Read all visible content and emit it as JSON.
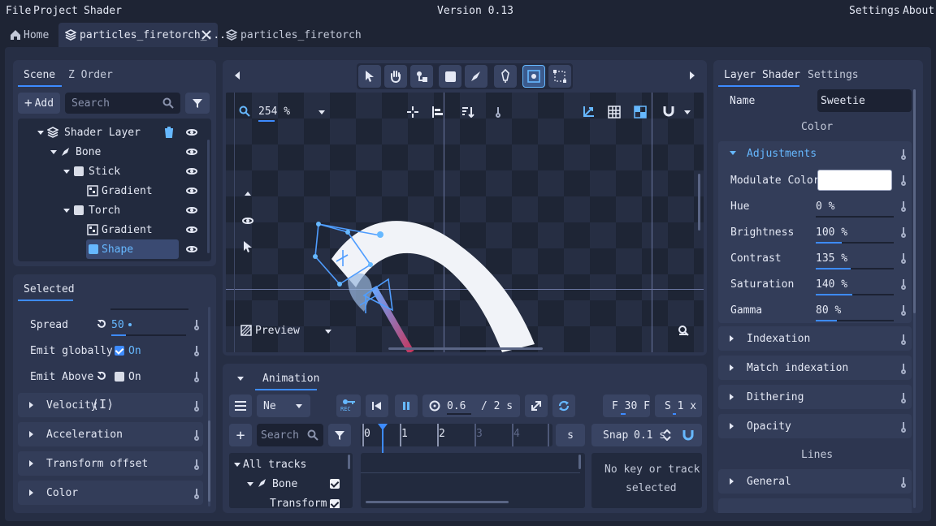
{
  "menu": {
    "file": "File",
    "project": "Project",
    "shader": "Shader",
    "version": "Version 0.13",
    "settings": "Settings",
    "about": "About"
  },
  "tabs": [
    {
      "label": "Home"
    },
    {
      "label": "particles_firetorch_..."
    },
    {
      "label": "particles_firetorch"
    }
  ],
  "scene": {
    "tab_scene": "Scene",
    "tab_zorder": "Z Order",
    "add": "Add",
    "search_placeholder": "Search",
    "tree": [
      {
        "label": "Shader Layer"
      },
      {
        "label": "Bone"
      },
      {
        "label": "Stick"
      },
      {
        "label": "Gradient"
      },
      {
        "label": "Torch"
      },
      {
        "label": "Gradient"
      },
      {
        "label": "Shape"
      }
    ]
  },
  "selected": {
    "title": "Selected",
    "spread_label": "Spread",
    "spread_value": "50",
    "emit_globally_label": "Emit globally",
    "emit_globally_value": "On",
    "emit_above_label": "Emit Above",
    "emit_above_value": "On",
    "sections": [
      {
        "label": "Velocity"
      },
      {
        "label": "Acceleration"
      },
      {
        "label": "Transform offset"
      },
      {
        "label": "Color"
      }
    ]
  },
  "viewport": {
    "zoom": "254 %",
    "preview": "Preview"
  },
  "animation": {
    "title": "Animation",
    "mode": "Ne",
    "rec": "REC",
    "time": "0.6",
    "duration": "/ 2 s",
    "fps": "F 30 F",
    "speed": "S 1 x",
    "search_placeholder": "Search",
    "ruler": [
      "0",
      "1",
      "2",
      "3",
      "4"
    ],
    "unit": "s",
    "snap_label": "Snap",
    "snap_value": "0.1 s",
    "tracks": [
      {
        "label": "All tracks"
      },
      {
        "label": "Bone"
      },
      {
        "label": "Transform"
      }
    ],
    "no_key_1": "No key or track",
    "no_key_2": "selected"
  },
  "inspector": {
    "tab_layer": "Layer Shader",
    "tab_settings": "Settings",
    "name_label": "Name",
    "name_value": "Sweetie",
    "color_header": "Color",
    "adjustments": "Adjustments",
    "modulate_label": "Modulate Color",
    "props": [
      {
        "label": "Hue",
        "value": "0 %",
        "level": 0
      },
      {
        "label": "Brightness",
        "value": "100 %",
        "level": 0.33
      },
      {
        "label": "Contrast",
        "value": "135 %",
        "level": 0.45
      },
      {
        "label": "Saturation",
        "value": "140 %",
        "level": 0.47
      },
      {
        "label": "Gamma",
        "value": "80 %",
        "level": 0.27
      }
    ],
    "sections": [
      {
        "label": "Indexation"
      },
      {
        "label": "Match indexation"
      },
      {
        "label": "Dithering"
      },
      {
        "label": "Opacity"
      }
    ],
    "lines_header": "Lines",
    "general": "General"
  }
}
